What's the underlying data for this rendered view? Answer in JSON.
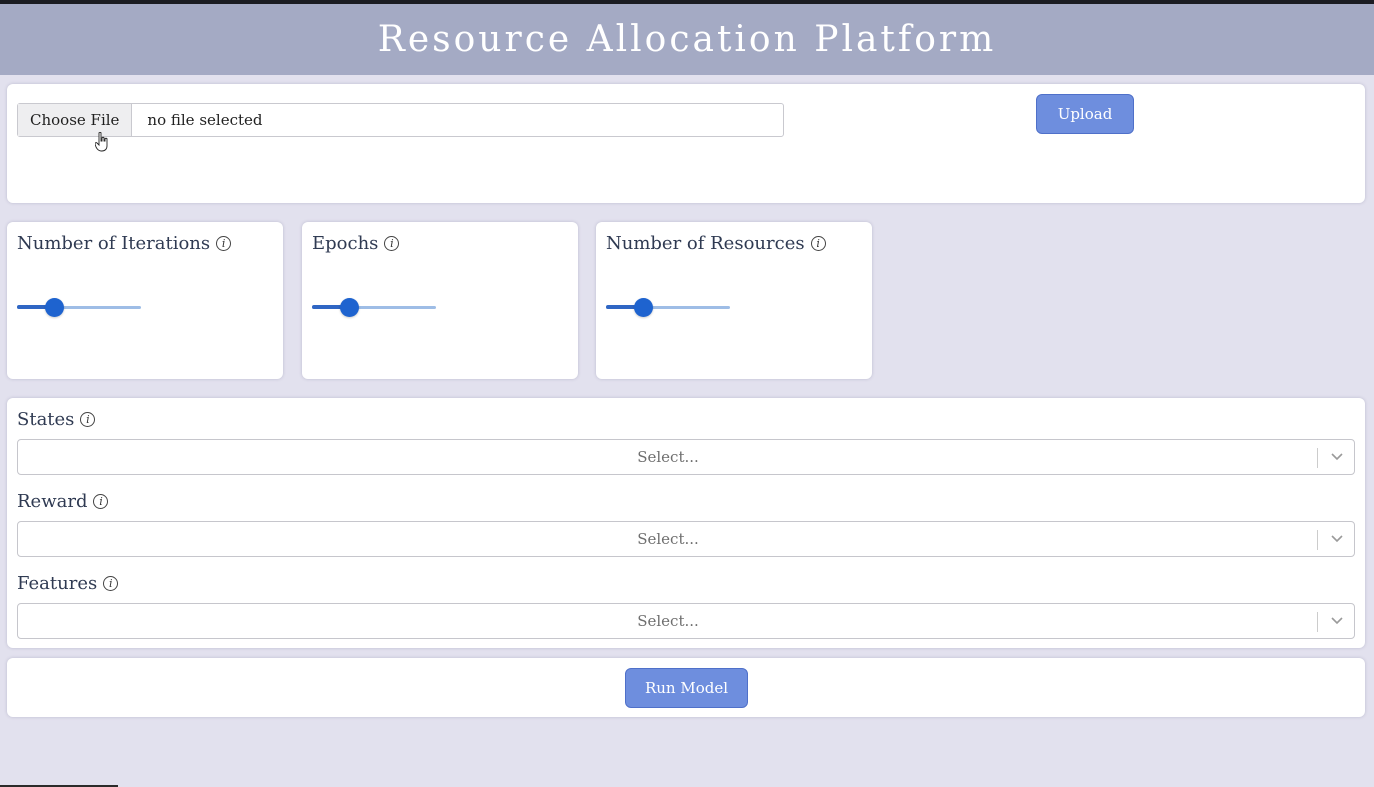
{
  "header": {
    "title": "Resource Allocation Platform"
  },
  "upload": {
    "choose_label": "Choose File",
    "file_status": "no file selected",
    "button_label": "Upload"
  },
  "sliders": [
    {
      "label": "Number of Iterations",
      "info": "i",
      "value_fraction": 0.3
    },
    {
      "label": "Epochs",
      "info": "i",
      "value_fraction": 0.3
    },
    {
      "label": "Number of Resources",
      "info": "i",
      "value_fraction": 0.3
    }
  ],
  "selects": [
    {
      "label": "States",
      "info": "i",
      "placeholder": "Select..."
    },
    {
      "label": "Reward",
      "info": "i",
      "placeholder": "Select..."
    },
    {
      "label": "Features",
      "info": "i",
      "placeholder": "Select..."
    }
  ],
  "run": {
    "button_label": "Run Model"
  },
  "colors": {
    "header_bg": "#a4aac4",
    "page_bg": "#e2e1ee",
    "button_bg": "#6e8ede",
    "slider_active": "#1e63cf",
    "slider_rail": "#9ebde6"
  }
}
